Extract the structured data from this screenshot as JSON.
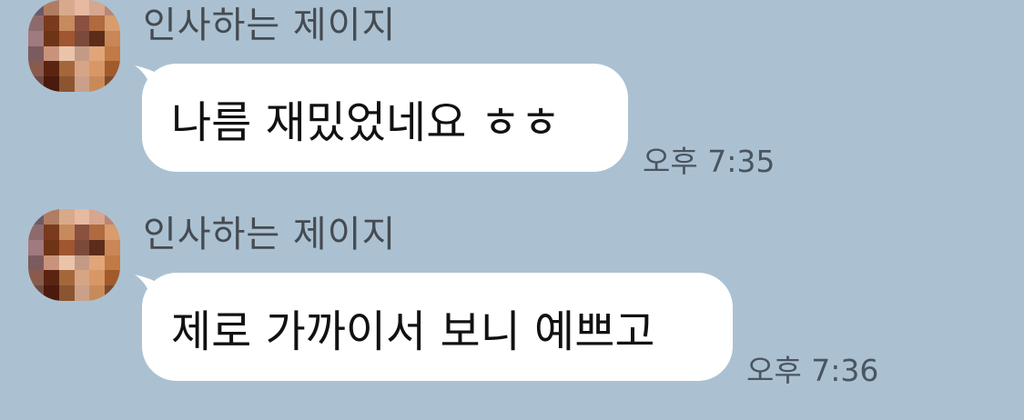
{
  "messages": [
    {
      "sender": "인사하는 제이지",
      "text": "나름 재밌었네요 ㅎㅎ",
      "time": "오후 7:35"
    },
    {
      "sender": "인사하는 제이지",
      "text": "제로 가까이서 보니 예쁘고",
      "time": "오후 7:36"
    }
  ],
  "colors": {
    "background": "#abc1d1",
    "bubble": "#ffffff",
    "sender_text": "#454b52",
    "time_text": "#4a5560"
  },
  "avatar_pixels": [
    [
      "#6b5a66",
      "#b07d62",
      "#d9a98b",
      "#e6b9a1",
      "#d7a68e",
      "#b88673"
    ],
    [
      "#8d6a6c",
      "#7a3a1e",
      "#c78a5d",
      "#8a5040",
      "#b06a3f",
      "#d89c6e"
    ],
    [
      "#a07a7e",
      "#6e3416",
      "#a05630",
      "#7c4a3a",
      "#5c2d1a",
      "#c98656"
    ],
    [
      "#7b5b5e",
      "#c9927a",
      "#e9c4ab",
      "#c49a85",
      "#e0a67a",
      "#c27a44"
    ],
    [
      "#8a5b4c",
      "#5a2410",
      "#a4673c",
      "#d6a585",
      "#d89766",
      "#a15a2c"
    ],
    [
      "#6e4a44",
      "#4a1a0c",
      "#8a5530",
      "#caa08a",
      "#c98a5a",
      "#7b4a2a"
    ]
  ]
}
